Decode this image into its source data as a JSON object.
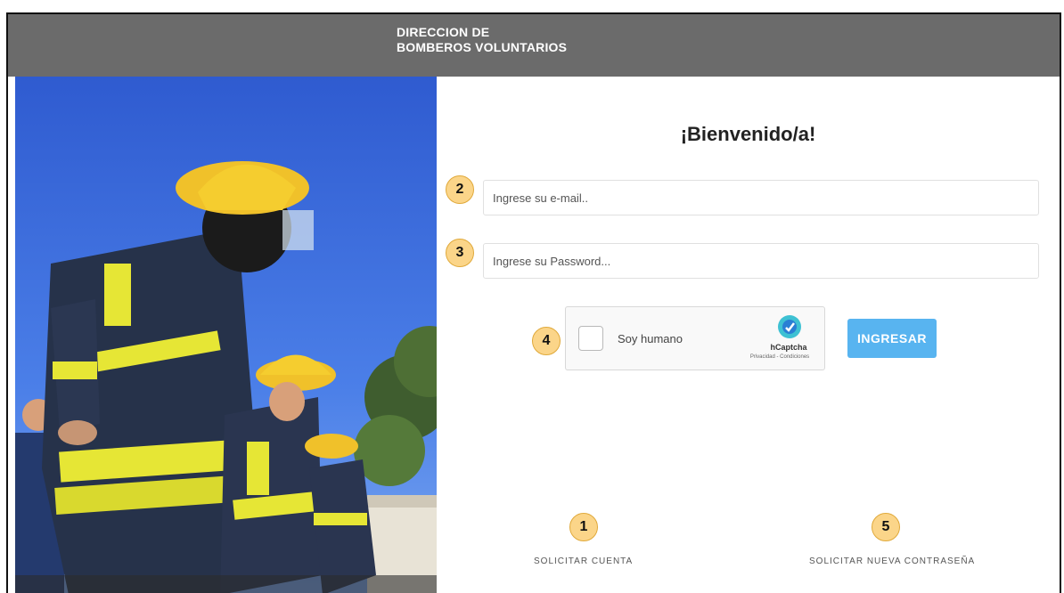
{
  "header": {
    "brand_line1": "DIRECCION DE",
    "brand_line2": "BOMBEROS VOLUNTARIOS"
  },
  "login": {
    "welcome": "¡Bienvenido/a!",
    "email_placeholder": "Ingrese su e-mail..",
    "password_placeholder": "Ingrese su Password...",
    "submit_label": "INGRESAR"
  },
  "captcha": {
    "label": "Soy humano",
    "brand": "hCaptcha",
    "links": "Privacidad - Condiciones"
  },
  "links": {
    "request_account": "SOLICITAR CUENTA",
    "request_password": "SOLICITAR NUEVA CONTRASEÑA"
  },
  "callouts": [
    "1",
    "2",
    "3",
    "4",
    "5"
  ],
  "colors": {
    "topbar": "#6b6b6b",
    "button": "#58b4f0",
    "callout": "#fbd589"
  },
  "photo": {
    "description_icon": "firefighters-photo"
  }
}
